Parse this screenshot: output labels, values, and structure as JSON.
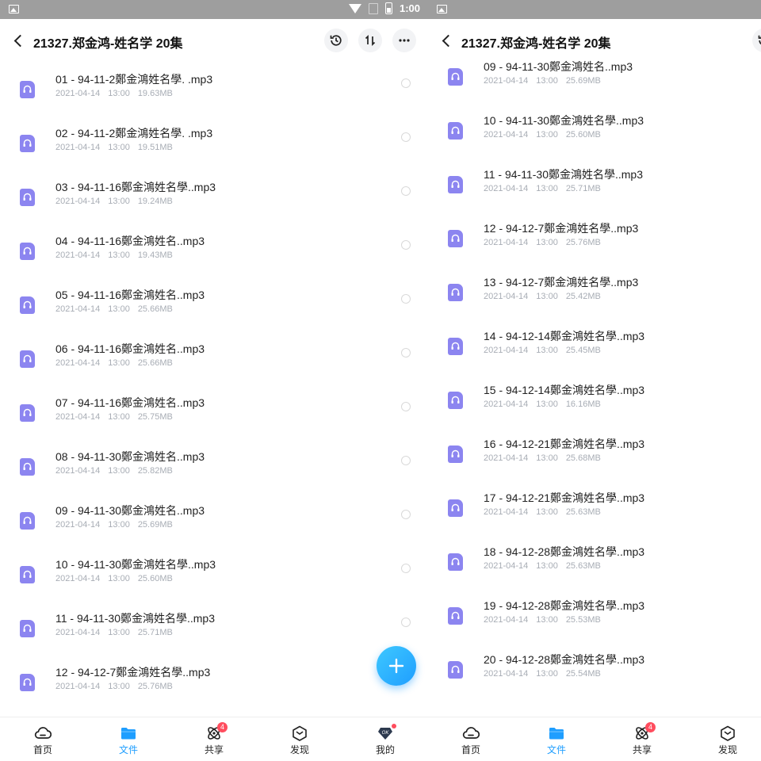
{
  "status_bar": {
    "time": "1:00"
  },
  "title": "21327.郑金鸿-姓名学 20集",
  "date": "2021-04-14",
  "time": "13:00",
  "left_list": [
    {
      "name": "01 - 94-11-2鄭金鴻姓名學. .mp3",
      "size": "19.63MB"
    },
    {
      "name": "02 - 94-11-2鄭金鴻姓名學. .mp3",
      "size": "19.51MB"
    },
    {
      "name": "03 - 94-11-16鄭金鴻姓名學..mp3",
      "size": "19.24MB"
    },
    {
      "name": "04 - 94-11-16鄭金鴻姓名..mp3",
      "size": "19.43MB"
    },
    {
      "name": "05 - 94-11-16鄭金鴻姓名..mp3",
      "size": "25.66MB"
    },
    {
      "name": "06 - 94-11-16鄭金鴻姓名..mp3",
      "size": "25.66MB"
    },
    {
      "name": "07 - 94-11-16鄭金鴻姓名..mp3",
      "size": "25.75MB"
    },
    {
      "name": "08 - 94-11-30鄭金鴻姓名..mp3",
      "size": "25.82MB"
    },
    {
      "name": "09 - 94-11-30鄭金鴻姓名..mp3",
      "size": "25.69MB"
    },
    {
      "name": "10 - 94-11-30鄭金鴻姓名學..mp3",
      "size": "25.60MB"
    },
    {
      "name": "11 - 94-11-30鄭金鴻姓名學..mp3",
      "size": "25.71MB"
    },
    {
      "name": "12 - 94-12-7鄭金鴻姓名學..mp3",
      "size": "25.76MB"
    }
  ],
  "right_list": [
    {
      "name": "09 - 94-11-30鄭金鴻姓名..mp3",
      "size": "25.69MB"
    },
    {
      "name": "10 - 94-11-30鄭金鴻姓名學..mp3",
      "size": "25.60MB"
    },
    {
      "name": "11 - 94-11-30鄭金鴻姓名學..mp3",
      "size": "25.71MB"
    },
    {
      "name": "12 - 94-12-7鄭金鴻姓名學..mp3",
      "size": "25.76MB"
    },
    {
      "name": "13 - 94-12-7鄭金鴻姓名學..mp3",
      "size": "25.42MB"
    },
    {
      "name": "14 - 94-12-14鄭金鴻姓名學..mp3",
      "size": "25.45MB"
    },
    {
      "name": "15 - 94-12-14鄭金鴻姓名學..mp3",
      "size": "16.16MB"
    },
    {
      "name": "16 - 94-12-21鄭金鴻姓名學..mp3",
      "size": "25.68MB"
    },
    {
      "name": "17 - 94-12-21鄭金鴻姓名學..mp3",
      "size": "25.63MB"
    },
    {
      "name": "18 - 94-12-28鄭金鴻姓名學..mp3",
      "size": "25.63MB"
    },
    {
      "name": "19 - 94-12-28鄭金鴻姓名學..mp3",
      "size": "25.53MB"
    },
    {
      "name": "20 - 94-12-28鄭金鴻姓名學..mp3",
      "size": "25.54MB"
    }
  ],
  "tabs": [
    {
      "label": "首页",
      "icon": "cloud-home-icon"
    },
    {
      "label": "文件",
      "icon": "folder-icon"
    },
    {
      "label": "共享",
      "icon": "share-atom-icon",
      "badge": "4"
    },
    {
      "label": "发现",
      "icon": "discover-cube-icon"
    },
    {
      "label": "我的",
      "icon": "profile-gem-icon"
    }
  ],
  "colors": {
    "accent": "#1f9eff",
    "file_icon": "#8c85f0",
    "badge": "#ff4d5e"
  }
}
